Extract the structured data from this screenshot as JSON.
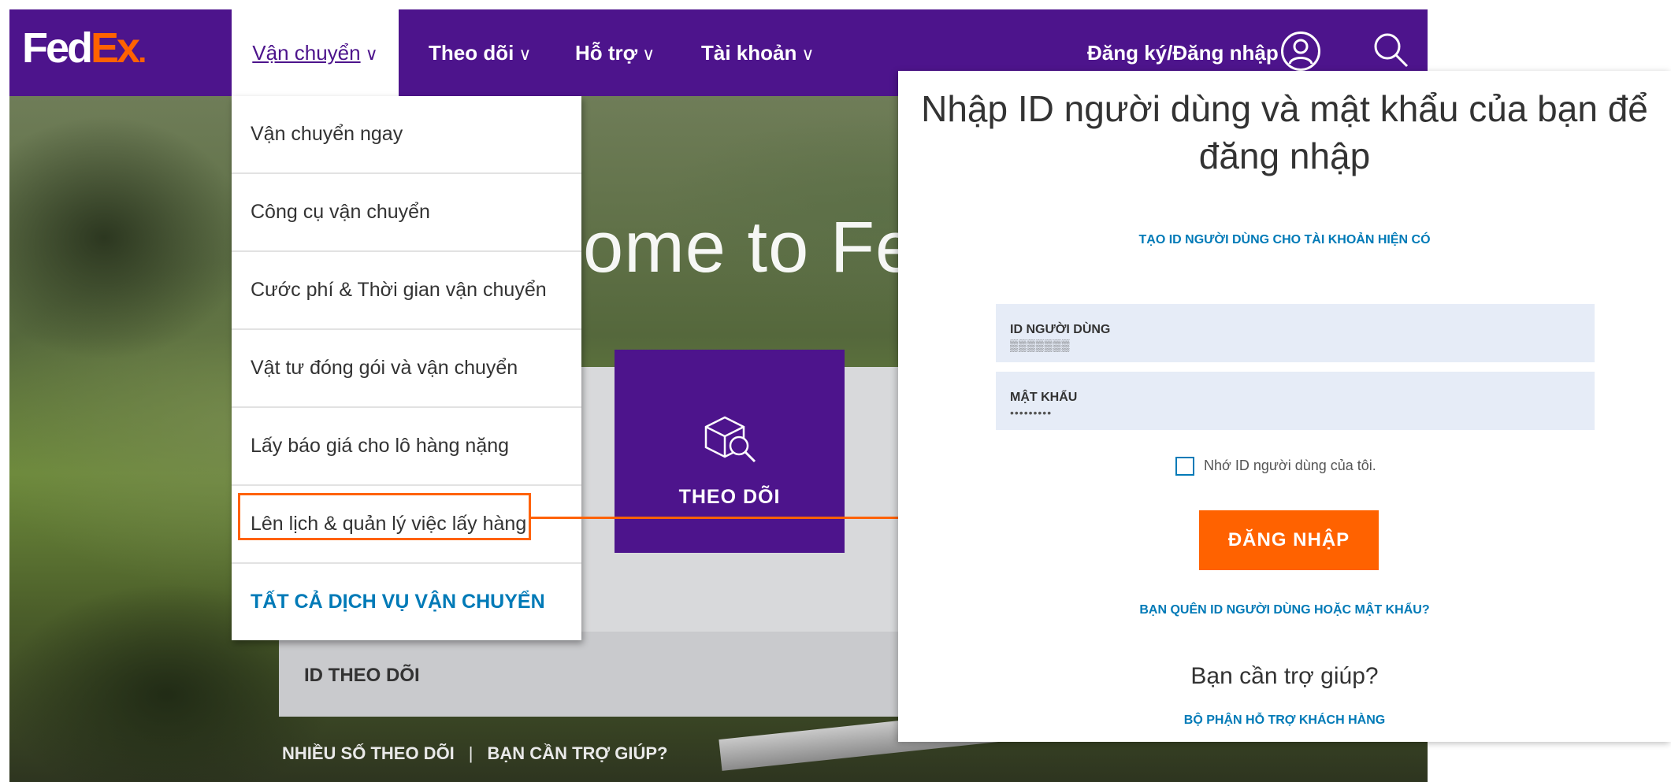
{
  "brand": {
    "logo_fed": "Fed",
    "logo_ex": "Ex",
    "logo_dot": ".",
    "purple": "#4d148c",
    "orange": "#ff6200",
    "link_blue": "#007ab7"
  },
  "nav": {
    "items": [
      {
        "label": "Vận chuyển",
        "state": "open"
      },
      {
        "label": "Theo dõi"
      },
      {
        "label": "Hỗ trợ"
      },
      {
        "label": "Tài khoản"
      }
    ],
    "chevron": "∨",
    "signin_label": "Đăng ký/Đăng nhập",
    "icons": [
      "user-icon",
      "search-icon"
    ]
  },
  "hero": {
    "welcome_text": "ome to Fe"
  },
  "dropdown": {
    "items": [
      "Vận chuyển ngay",
      "Công cụ vận chuyển",
      "Cước phí & Thời gian vận chuyển",
      "Vật tư đóng gói và vận chuyển",
      "Lấy báo giá cho lô hàng nặng",
      "Lên lịch & quản lý việc lấy hàng"
    ],
    "all_services": "TẤT CẢ DỊCH VỤ VẬN CHUYỂN",
    "highlighted_item": "Lên lịch & quản lý việc lấy hàng"
  },
  "tracking": {
    "tile_label": "THEO DÕI",
    "id_label": "ID THEO DÕI",
    "links": [
      "NHIỀU SỐ THEO DÕI",
      "BẠN CẦN TRỢ GIÚP?"
    ],
    "separator": "|"
  },
  "login": {
    "title": "Nhập ID người dùng và mật khẩu của bạn để đăng nhập",
    "create_id_link": "TẠO ID NGƯỜI DÙNG CHO TÀI KHOẢN HIỆN CÓ",
    "user_label": "ID NGƯỜI DÙNG",
    "user_value": "▒▒▒▒▒▒▒",
    "password_label": "MẬT KHẨU",
    "password_value": "•••••••••",
    "remember_label": "Nhớ ID người dùng của tôi.",
    "remember_checked": false,
    "login_button": "ĐĂNG NHẬP",
    "forgot_link": "BẠN QUÊN ID NGƯỜI DÙNG HOẶC MẬT KHẨU?",
    "help_question": "Bạn cần trợ giúp?",
    "support_link": "BỘ PHẬN HỖ TRỢ KHÁCH HÀNG"
  }
}
